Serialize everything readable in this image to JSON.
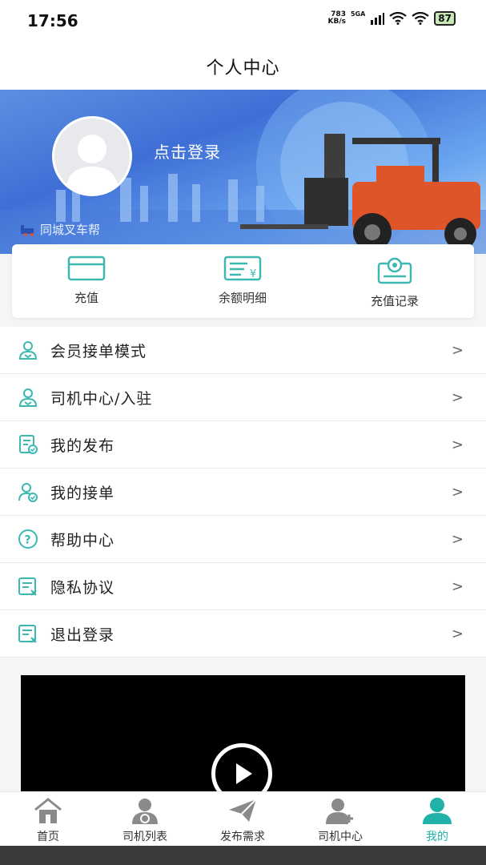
{
  "status_bar": {
    "time": "17:56",
    "net_speed_value": "783",
    "net_speed_unit": "KB/s",
    "signal_label": "5GA",
    "battery": "87"
  },
  "header": {
    "title": "个人中心"
  },
  "profile": {
    "login_text": "点击登录",
    "brand_text": "同城叉车帮"
  },
  "quick_actions": [
    {
      "label": "充值",
      "icon": "wallet-card-icon"
    },
    {
      "label": "余额明细",
      "icon": "balance-detail-icon"
    },
    {
      "label": "充值记录",
      "icon": "recharge-record-icon"
    }
  ],
  "menu": [
    {
      "label": "会员接单模式",
      "icon": "user-member-icon"
    },
    {
      "label": "司机中心/入驻",
      "icon": "user-driver-icon"
    },
    {
      "label": "我的发布",
      "icon": "document-check-icon"
    },
    {
      "label": "我的接单",
      "icon": "user-check-icon"
    },
    {
      "label": "帮助中心",
      "icon": "help-circle-icon"
    },
    {
      "label": "隐私协议",
      "icon": "privacy-doc-icon"
    },
    {
      "label": "退出登录",
      "icon": "logout-doc-icon"
    }
  ],
  "chevron": ">",
  "tabs": [
    {
      "label": "首页",
      "icon": "home-icon"
    },
    {
      "label": "司机列表",
      "icon": "driver-list-icon"
    },
    {
      "label": "发布需求",
      "icon": "paper-plane-icon"
    },
    {
      "label": "司机中心",
      "icon": "user-add-icon"
    },
    {
      "label": "我的",
      "icon": "profile-icon",
      "active": true
    }
  ],
  "colors": {
    "accent": "#20b2a8",
    "icon_gray": "#888888"
  }
}
